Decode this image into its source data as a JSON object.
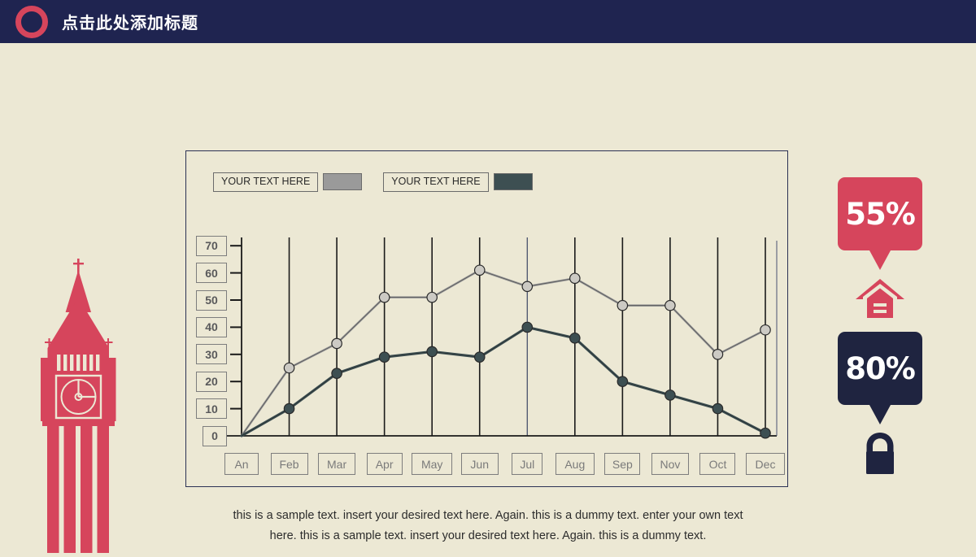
{
  "header": {
    "title": "点击此处添加标题",
    "logo_icon": "ring-logo-icon",
    "bg_color": "#1f2450",
    "accent_color": "#d6455c"
  },
  "page": {
    "background_color": "#ece8d4",
    "caption_line1": "this is a sample text. insert your desired text here. Again. this is a dummy text. enter your own text",
    "caption_line2": "here. this is a sample text. insert your desired text here. Again. this is a dummy text."
  },
  "decorations": {
    "tower_icon": "big-ben-tower-icon",
    "tower_color": "#d6455c"
  },
  "callouts": [
    {
      "value": "55%",
      "color": "#d6455c",
      "icon": "home-icon",
      "icon_name": "home"
    },
    {
      "value": "80%",
      "color": "#1f2440",
      "icon": "lock-icon",
      "icon_name": "lock"
    }
  ],
  "chart_data": {
    "type": "line",
    "title": "",
    "xlabel": "",
    "ylabel": "",
    "ylim": [
      0,
      70
    ],
    "yticks": [
      0,
      10,
      20,
      30,
      40,
      50,
      60,
      70
    ],
    "ytick_labels": [
      "0",
      "10",
      "20",
      "30",
      "40",
      "50",
      "60",
      "70"
    ],
    "grid": true,
    "grid_orientation": "vertical",
    "legend_position": "top-left",
    "categories": [
      "An",
      "Feb",
      "Mar",
      "Apr",
      "May",
      "Jun",
      "Jul",
      "Aug",
      "Sep",
      "Nov",
      "Oct",
      "Dec"
    ],
    "series": [
      {
        "name": "YOUR TEXT HERE",
        "color": "#9a9a9a",
        "marker_fill": "#cccac4",
        "values": [
          0,
          25,
          34,
          51,
          51,
          61,
          55,
          58,
          48,
          48,
          30,
          39
        ]
      },
      {
        "name": "YOUR TEXT HERE",
        "color": "#3d4f52",
        "marker_fill": "#3d4f52",
        "values": [
          0,
          10,
          23,
          29,
          31,
          29,
          40,
          36,
          20,
          15,
          10,
          1
        ]
      }
    ]
  }
}
